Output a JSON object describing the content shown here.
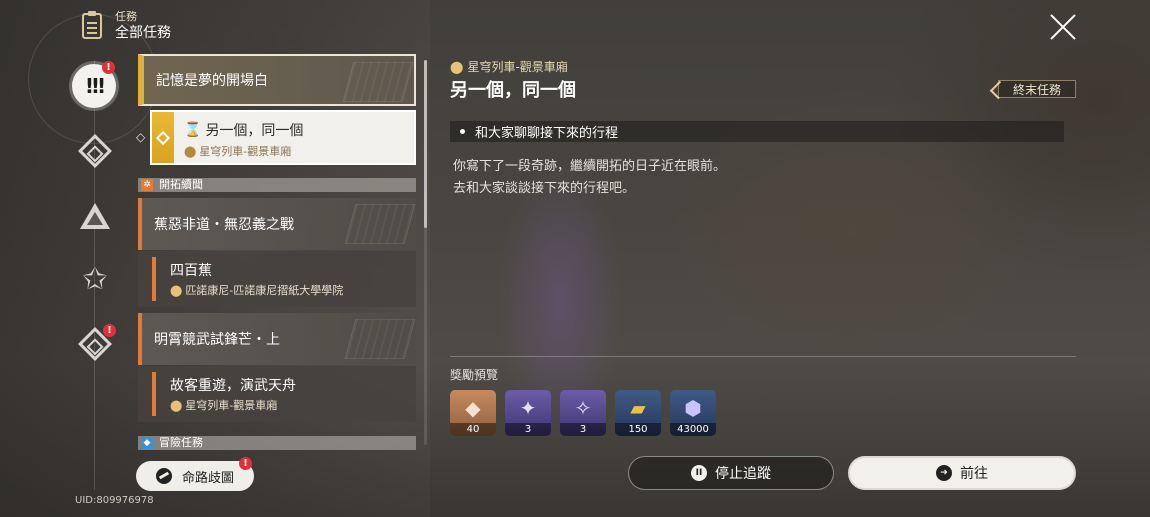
{
  "header": {
    "subtitle": "任務",
    "title": "全部任務",
    "icon": "clipboard-icon"
  },
  "categories": [
    {
      "name": "all-quests",
      "icon": "exclamation-icon",
      "active": true,
      "badge": "!"
    },
    {
      "name": "trailblaze",
      "icon": "diamond-icon",
      "active": false
    },
    {
      "name": "companion",
      "icon": "triangle-icon",
      "active": false
    },
    {
      "name": "adventure",
      "icon": "star-icon",
      "active": false
    },
    {
      "name": "daily",
      "icon": "diamond-icon",
      "active": false,
      "badge": "!"
    }
  ],
  "quest_list": {
    "top_quest": "記憶是夢的開場白",
    "selected": {
      "title": "另一個，同一個",
      "location": "星穹列車-觀景車廂"
    },
    "section_trailblaze": "開拓續聞",
    "trailblaze_quests": [
      {
        "title": "蕉惡非道・無忍義之戰"
      },
      {
        "sub_title": "四百蕉",
        "location": "匹諾康尼-匹諾康尼摺紙大學學院"
      },
      {
        "title": "明霄競武試鋒芒・上"
      },
      {
        "sub_title": "故客重遊，演武天舟",
        "location": "星穹列車-觀景車廂"
      }
    ],
    "section_adventure": "冒險任務"
  },
  "bottom_left": {
    "map_button": "命路歧圖",
    "map_badge": "!",
    "uid": "UID:809976978"
  },
  "detail": {
    "location": "星穹列車-觀景車廂",
    "title": "另一個，同一個",
    "type_badge": "終末任務",
    "objective": "和大家聊聊接下來的行程",
    "description_1": "你寫下了一段奇跡，繼續開拓的日子近在眼前。",
    "description_2": "去和大家談談接下來的行程吧。",
    "rewards_label": "獎勵預覽",
    "rewards": [
      {
        "icon": "crystal-icon",
        "count": "40"
      },
      {
        "icon": "purple-material-icon",
        "count": "3"
      },
      {
        "icon": "purple-material-icon",
        "count": "3"
      },
      {
        "icon": "gold-ticket-icon",
        "count": "150"
      },
      {
        "icon": "credit-icon",
        "count": "43000"
      }
    ],
    "stop_button": "停止追蹤",
    "go_button": "前往"
  },
  "colors": {
    "accent_orange": "#e07b38",
    "accent_gold": "#e2ae3c",
    "badge_red": "#e0313a"
  }
}
